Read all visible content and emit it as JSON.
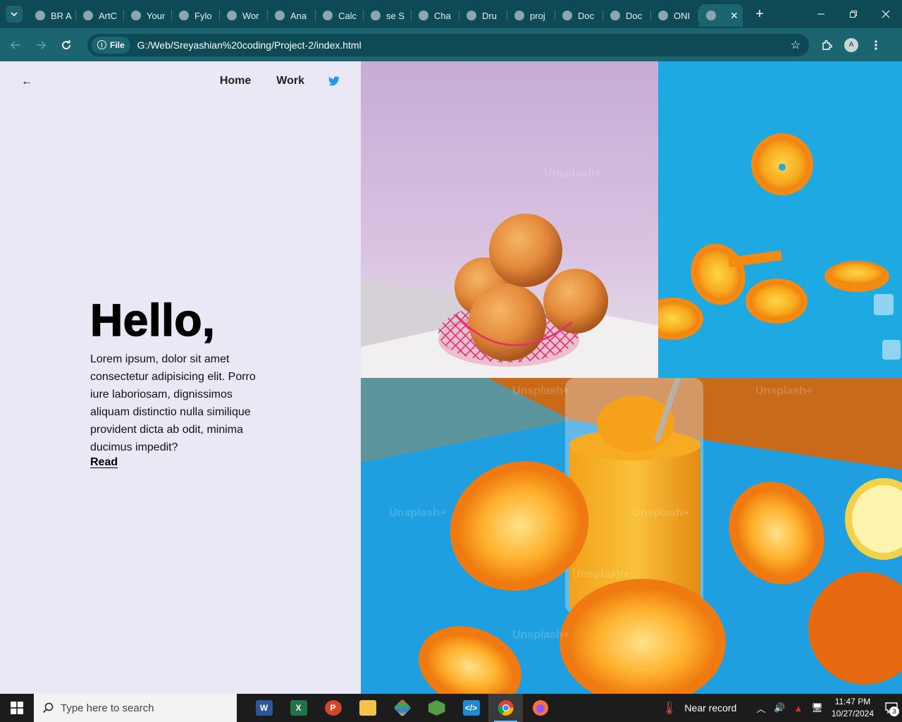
{
  "browser": {
    "tabs": [
      {
        "title": "BR A",
        "icon": "globe-icon"
      },
      {
        "title": "ArtC",
        "icon": "globe-icon"
      },
      {
        "title": "Your",
        "icon": "me-icon"
      },
      {
        "title": "Fylo",
        "icon": "fylo-icon"
      },
      {
        "title": "Wor",
        "icon": "globe-icon"
      },
      {
        "title": "Ana",
        "icon": "globe-icon"
      },
      {
        "title": "Calc",
        "icon": "globe-icon"
      },
      {
        "title": "se S",
        "icon": "color-grid-icon"
      },
      {
        "title": "Cha",
        "icon": "chatgpt-icon"
      },
      {
        "title": "Dru",
        "icon": "globe-icon"
      },
      {
        "title": "proj",
        "icon": "globe-icon"
      },
      {
        "title": "Doc",
        "icon": "globe-icon"
      },
      {
        "title": "Doc",
        "icon": "globe-icon"
      },
      {
        "title": "ONI",
        "icon": "globe-icon"
      }
    ],
    "active_tab_title": "",
    "url_chip": "File",
    "url": "G:/Web/Sreyashian%20coding/Project-2/index.html",
    "profile_initial": "A",
    "new_tab_symbol": "+",
    "close_symbol": "✕"
  },
  "page": {
    "nav": {
      "back_symbol": "←",
      "home": "Home",
      "work": "Work",
      "social_icon": "twitter-icon"
    },
    "hero": {
      "title": "Hello,",
      "body": "Lorem ipsum, dolor sit amet consectetur adipisicing elit. Porro iure laboriosam, dignissimos aliquam distinctio nulla similique provident dicta ab odit, minima ducimus impedit?",
      "link": "Read"
    },
    "watermark": "Unsplash+",
    "colors": {
      "left_bg": "#e9e8f4",
      "twitter": "#1d9bf0",
      "orange": "#f39a1a",
      "sky_blue": "#1ea9e3"
    }
  },
  "taskbar": {
    "search_placeholder": "Type here to search",
    "apps": [
      "word-icon",
      "excel-icon",
      "powerpoint-icon",
      "file-explorer-icon",
      "git-icon",
      "nodejs-icon",
      "vscode-icon",
      "chrome-icon",
      "firefox-icon"
    ],
    "weather": "Near record",
    "time": "11:47 PM",
    "date": "10/27/2024",
    "notification_count": "3"
  }
}
